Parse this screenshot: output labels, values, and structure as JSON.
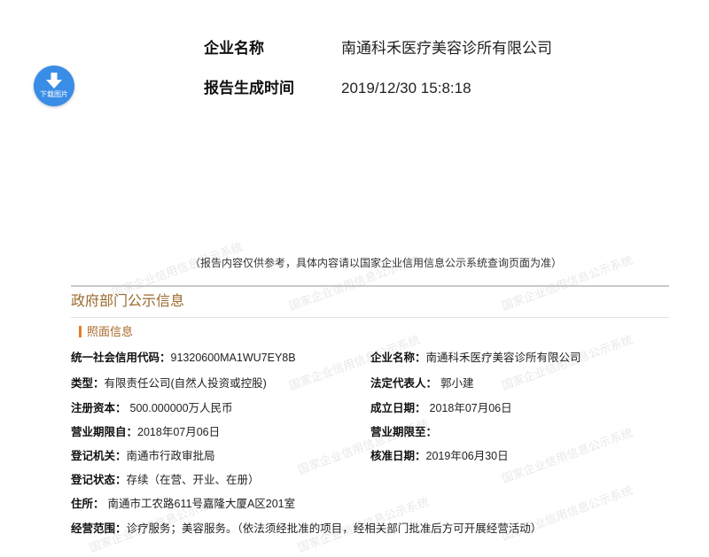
{
  "header": {
    "company_label": "企业名称",
    "company_value": "南通科禾医疗美容诊所有限公司",
    "report_time_label": "报告生成时间",
    "report_time_value": "2019/12/30 15:8:18"
  },
  "download_button": {
    "label": "下载图片",
    "icon": "download-arrow-icon",
    "color": "#3a8de6"
  },
  "notice": "（报告内容仅供参考，具体内容请以国家企业信用信息公示系统查询页面为准）",
  "section": {
    "title": "政府部门公示信息",
    "color": "#9a6a2e"
  },
  "subsection": {
    "title": "照面信息",
    "color": "#a8682a",
    "accent_color": "#e87b2c"
  },
  "fields": {
    "credit_code": {
      "label": "统一社会信用代码：",
      "value": "91320600MA1WU7EY8B"
    },
    "company_name": {
      "label": "企业名称：",
      "value": "南通科禾医疗美容诊所有限公司"
    },
    "type": {
      "label": "类型：",
      "value": "有限责任公司(自然人投资或控股)"
    },
    "legal_rep": {
      "label": "法定代表人：",
      "value": "郭小建"
    },
    "registered_capital": {
      "label": "注册资本：",
      "value": "500.000000万人民币"
    },
    "established_date": {
      "label": "成立日期：",
      "value": "2018年07月06日"
    },
    "term_from": {
      "label": "营业期限自：",
      "value": "2018年07月06日"
    },
    "term_to": {
      "label": "营业期限至："
    },
    "registration_authority": {
      "label": "登记机关：",
      "value": "南通市行政审批局"
    },
    "approval_date": {
      "label": "核准日期：",
      "value": "2019年06月30日"
    },
    "status": {
      "label": "登记状态：",
      "value": "存续（在营、开业、在册）"
    },
    "address": {
      "label": "住所：",
      "value": "南通市工农路611号嘉隆大厦A区201室"
    },
    "business_scope": {
      "label": "经营范围：",
      "value": "诊疗服务；美容服务。（依法须经批准的项目，经相关部门批准后方可开展经营活动）"
    }
  },
  "watermark": {
    "text": "国家企业信用信息公示系统"
  }
}
